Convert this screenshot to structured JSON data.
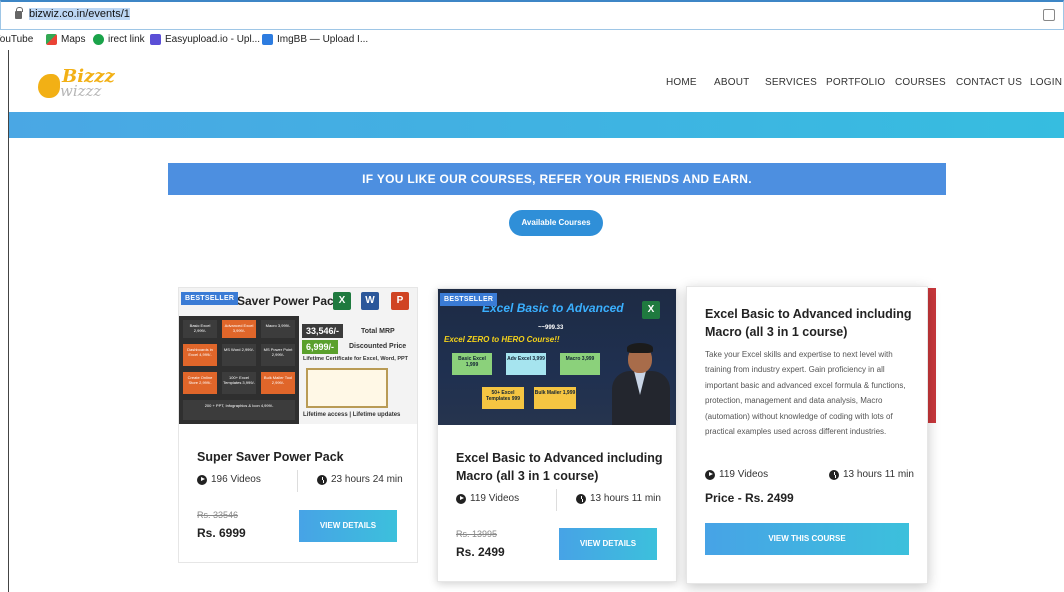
{
  "browser": {
    "url": "bizwiz.co.in/events/1",
    "bookmarks": [
      {
        "label": "YouTube",
        "icon": "youtube-icon"
      },
      {
        "label": "Maps",
        "icon": "maps-icon"
      },
      {
        "label": "irect link",
        "icon": "link-icon"
      },
      {
        "label": "Easyupload.io - Upl...",
        "icon": "easyupload-icon"
      },
      {
        "label": "ImgBB — Upload I...",
        "icon": "imgbb-icon"
      }
    ]
  },
  "site": {
    "logo_top": "Bizzz",
    "logo_bottom": "wizzz",
    "nav": [
      "HOME",
      "ABOUT",
      "SERVICES",
      "PORTFOLIO",
      "COURSES",
      "CONTACT US",
      "LOGIN"
    ],
    "banner": "IF YOU LIKE OUR COURSES, REFER YOUR FRIENDS AND EARN.",
    "available_btn": "Available Courses"
  },
  "courses": [
    {
      "badge": "BESTSELLER",
      "thumb_title": "Saver Power Pack",
      "thumb": {
        "tiles": [
          "Basic Excel 2,999/-",
          "Advanced Excel 3,999/-",
          "Macro 3,999/-",
          "Dashboards in Excel 4,999/-",
          "MS Word 2,999/-",
          "MS Power Point 2,999/-",
          "Create Online Store 2,999/-",
          "100+ Excel Templates 3,999/-",
          "Bulk Mailer Tool 2,999/-",
          "200 + PPT, Infographics & Icon 4,999/-"
        ],
        "mrp_value": "33,546/-",
        "mrp_label": "Total MRP",
        "disc_value": "6,999/-",
        "disc_label": "Discounted Price",
        "cert_text": "Lifetime Certificate for Excel, Word, PPT",
        "footer": "Lifetime access | Lifetime updates"
      },
      "title": "Super Saver Power Pack",
      "videos": "196 Videos",
      "duration": "23 hours 24 min",
      "old_price": "Rs. 33546",
      "price": "Rs. 6999",
      "button": "VIEW DETAILS"
    },
    {
      "badge": "BESTSELLER",
      "thumb_title": "Excel Basic to Advanced",
      "thumb": {
        "sub": "Excel ZERO to HERO Course!!",
        "small_price": "~~999.33",
        "tiles": [
          "Basic Excel 1,999",
          "Adv Excel 3,999",
          "Macro 3,999",
          "50+ Excel Templates 999",
          "Bulk Mailer 1,999"
        ]
      },
      "title": "Excel Basic to Advanced including Macro (all 3 in 1 course)",
      "videos": "119 Videos",
      "duration": "13 hours 11 min",
      "old_price": "Rs. 13995",
      "price": "Rs. 2499",
      "button": "VIEW DETAILS"
    },
    {
      "title": "Excel Basic to Advanced including Macro (all 3 in 1 course)",
      "description": "Take your Excel skills and expertise to next level with training from industry expert. Gain proficiency in all important basic and advanced excel formula & functions, protection, management and data analysis, Macro (automation) without knowledge of coding with lots of practical examples used across different industries.",
      "videos": "119 Videos",
      "duration": "13 hours 11 min",
      "price": "Price - Rs. 2499",
      "button": "VIEW THIS COURSE"
    }
  ],
  "colors": {
    "accent": "#4d8fe0",
    "button_gradient_start": "#47a3e6",
    "button_gradient_end": "#3cc0dc",
    "logo_yellow": "#f2b015"
  }
}
